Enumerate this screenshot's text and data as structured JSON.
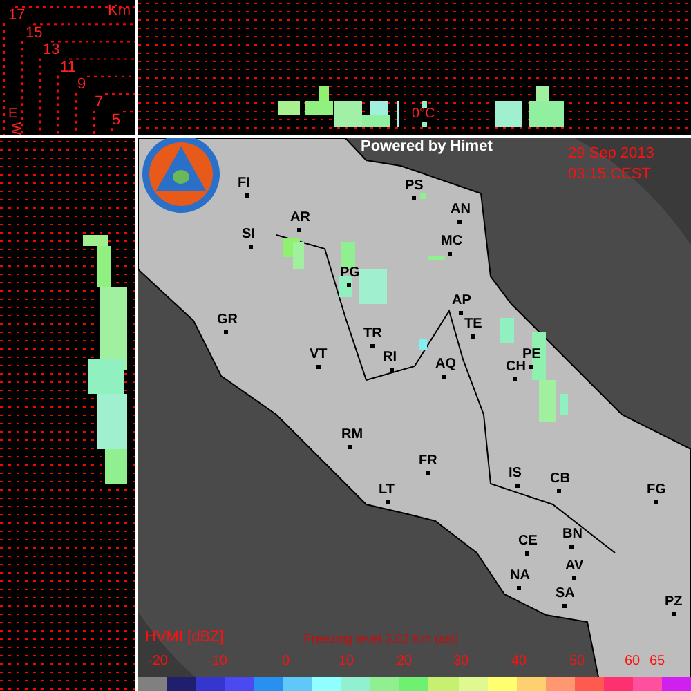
{
  "header": {
    "credit": "Powered by Himet",
    "date": "29 Sep 2013",
    "time": "03:15 CEST"
  },
  "height_scale": {
    "unit": "Km",
    "labels": [
      "17",
      "15",
      "13",
      "11",
      "9",
      "7",
      "5"
    ],
    "axis_labels": [
      "E",
      "W"
    ]
  },
  "freezing_marker": "0°C",
  "cities": [
    "PS",
    "FI",
    "AN",
    "AR",
    "SI",
    "MC",
    "PG",
    "AP",
    "GR",
    "TE",
    "TR",
    "VT",
    "RI",
    "PE",
    "AQ",
    "CH",
    "RM",
    "FR",
    "IS",
    "CB",
    "LT",
    "FG",
    "BN",
    "CE",
    "AV",
    "NA",
    "SA",
    "PZ"
  ],
  "legend": {
    "product": "HVMI [dBZ]",
    "freezing_level": "Freezing level  3.02 Km (asl)",
    "ticks": [
      "-20",
      "-10",
      "0",
      "10",
      "20",
      "30",
      "40",
      "50",
      "60",
      "65"
    ],
    "bins": [
      {
        "color": "#808080"
      },
      {
        "color": "#1f1f6e"
      },
      {
        "color": "#3535d0"
      },
      {
        "color": "#4a4af0"
      },
      {
        "color": "#2890f0"
      },
      {
        "color": "#60c8f8"
      },
      {
        "color": "#90ffff"
      },
      {
        "color": "#90f0d0"
      },
      {
        "color": "#90f090"
      },
      {
        "color": "#70f070"
      },
      {
        "color": "#c8f070"
      },
      {
        "color": "#e0f890"
      },
      {
        "color": "#ffff70"
      },
      {
        "color": "#ffd070"
      },
      {
        "color": "#ff9870"
      },
      {
        "color": "#ff5a50"
      },
      {
        "color": "#ff3070"
      },
      {
        "color": "#ff50a0"
      },
      {
        "color": "#d020f0"
      }
    ]
  }
}
